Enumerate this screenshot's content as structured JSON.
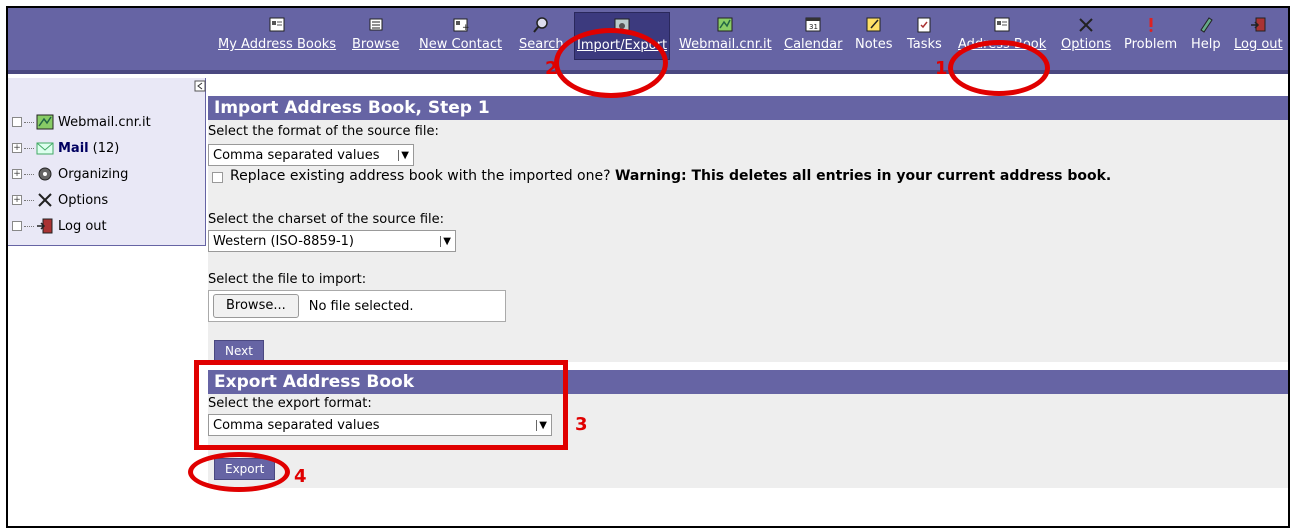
{
  "toolbar": {
    "items": [
      {
        "label": "My Address Books",
        "icon": "address-book-icon"
      },
      {
        "label": "Browse",
        "icon": "browse-icon"
      },
      {
        "label": "New Contact",
        "icon": "new-contact-icon"
      },
      {
        "label": "Search",
        "icon": "search-icon"
      },
      {
        "label": "Import/Export",
        "icon": "import-export-icon"
      },
      {
        "label": "Webmail.cnr.it",
        "icon": "webmail-icon"
      },
      {
        "label": "Calendar",
        "icon": "calendar-icon"
      },
      {
        "label": "Notes",
        "icon": "notes-icon"
      },
      {
        "label": "Tasks",
        "icon": "tasks-icon"
      },
      {
        "label": "Address Book",
        "icon": "address-book-icon"
      },
      {
        "label": "Options",
        "icon": "options-icon"
      },
      {
        "label": "Problem",
        "icon": "problem-icon"
      },
      {
        "label": "Help",
        "icon": "help-icon"
      },
      {
        "label": "Log out",
        "icon": "logout-icon"
      }
    ]
  },
  "sidebar": {
    "items": [
      {
        "label": "Webmail.cnr.it",
        "expand": "",
        "bold": false,
        "count": ""
      },
      {
        "label": "Mail",
        "expand": "+",
        "bold": true,
        "count": "(12)"
      },
      {
        "label": "Organizing",
        "expand": "+",
        "bold": false,
        "count": ""
      },
      {
        "label": "Options",
        "expand": "+",
        "bold": false,
        "count": ""
      },
      {
        "label": "Log out",
        "expand": "",
        "bold": false,
        "count": ""
      }
    ]
  },
  "import": {
    "title": "Import Address Book, Step 1",
    "format_label": "Select the format of the source file:",
    "format_value": "Comma separated values",
    "replace_label": "Replace existing address book with the imported one?",
    "replace_warning": "Warning: This deletes all entries in your current address book.",
    "charset_label": "Select the charset of the source file:",
    "charset_value": "Western (ISO-8859-1)",
    "file_label": "Select the file to import:",
    "browse_label": "Browse...",
    "file_status": "No file selected.",
    "next_label": "Next"
  },
  "export": {
    "title": "Export Address Book",
    "format_label": "Select the export format:",
    "format_value": "Comma separated values",
    "export_label": "Export"
  },
  "annotations": {
    "n1": "1",
    "n2": "2",
    "n3": "3",
    "n4": "4",
    "color": "#e00000"
  },
  "colors": {
    "header": "#6664a4",
    "sidebar_bg": "#e9e8f6",
    "section_bg": "#eeeeee"
  }
}
